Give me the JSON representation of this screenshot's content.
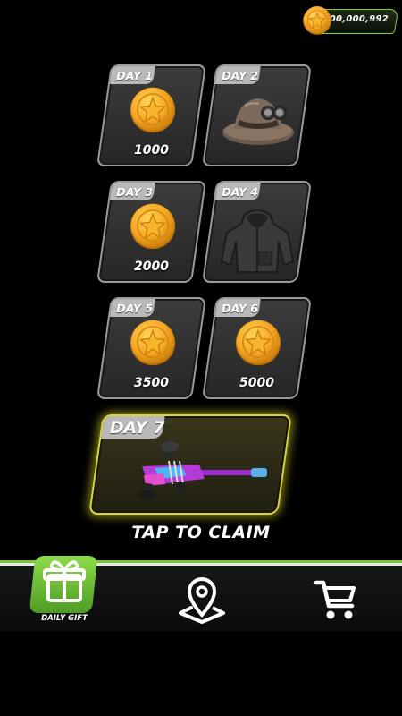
{
  "currency": {
    "amount": "100,000,992",
    "icon": "coin-icon"
  },
  "days": [
    {
      "label": "DAY 1",
      "reward_type": "coin",
      "amount": "1000"
    },
    {
      "label": "DAY 2",
      "reward_type": "pith-helmet",
      "amount": ""
    },
    {
      "label": "DAY 3",
      "reward_type": "coin",
      "amount": "2000"
    },
    {
      "label": "DAY 4",
      "reward_type": "hoodie",
      "amount": ""
    },
    {
      "label": "DAY 5",
      "reward_type": "coin",
      "amount": "3500"
    },
    {
      "label": "DAY 6",
      "reward_type": "coin",
      "amount": "5000"
    },
    {
      "label": "DAY 7",
      "reward_type": "paintball-rifle",
      "amount": ""
    }
  ],
  "claim_text": "TAP TO CLAIM",
  "nav": {
    "items": [
      {
        "label": "DAILY GIFT",
        "icon": "gift-icon",
        "active": true
      },
      {
        "label": "",
        "icon": "map-pin-icon",
        "active": false
      },
      {
        "label": "",
        "icon": "shopping-cart-icon",
        "active": false
      }
    ]
  },
  "colors": {
    "accent_green": "#7fc23a",
    "day7_glow": "#d8d63a",
    "coin_gold": "#f5a623",
    "card_border": "#9a9a9a"
  }
}
